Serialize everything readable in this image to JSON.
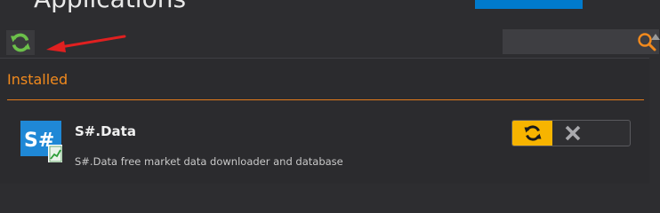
{
  "header": {
    "title": "Applications"
  },
  "toolbar": {
    "refresh_icon": "refresh-icon",
    "search": {
      "value": "",
      "placeholder": "",
      "icon": "search-icon"
    }
  },
  "colors": {
    "accent_orange": "#f28a1d",
    "refresh_green": "#6cc04a",
    "update_yellow": "#f7b400",
    "annotation_red": "#e02020",
    "brand_blue": "#007acc"
  },
  "installed": {
    "section_title": "Installed",
    "apps": [
      {
        "name": "S#.Data",
        "description": "S#.Data free market data downloader and database",
        "icon_text": "S#",
        "actions": {
          "update_icon": "update-icon",
          "remove_icon": "close-icon"
        }
      }
    ]
  }
}
